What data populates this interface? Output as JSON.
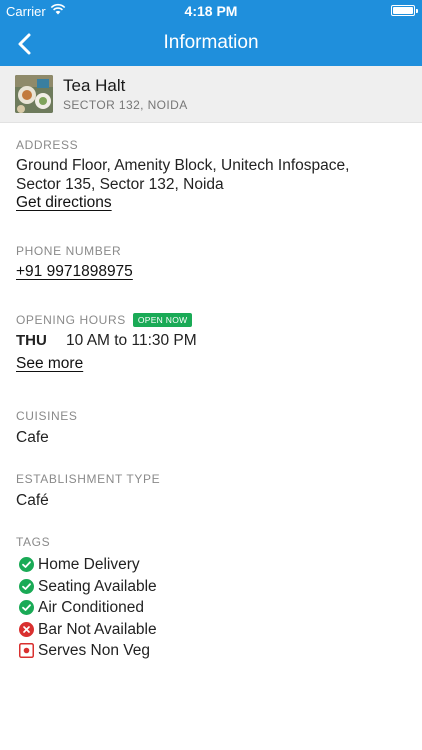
{
  "status_bar": {
    "carrier": "Carrier",
    "time": "4:18 PM"
  },
  "nav": {
    "title": "Information"
  },
  "restaurant": {
    "name": "Tea Halt",
    "location": "SECTOR 132, NOIDA"
  },
  "address": {
    "label": "ADDRESS",
    "line1": "Ground Floor, Amenity Block, Unitech Infospace,",
    "line2": "Sector 135, Sector 132, Noida",
    "directions_link": "Get directions"
  },
  "phone": {
    "label": "PHONE NUMBER",
    "number": "+91 9971898975"
  },
  "hours": {
    "label": "OPENING HOURS",
    "badge": "OPEN NOW",
    "day": "THU",
    "time": "10 AM to 11:30 PM",
    "see_more": "See more"
  },
  "cuisines": {
    "label": "CUISINES",
    "value": "Cafe"
  },
  "establishment": {
    "label": "ESTABLISHMENT TYPE",
    "value": "Café"
  },
  "tags": {
    "label": "TAGS",
    "items": [
      {
        "label": "Home Delivery",
        "status": "yes"
      },
      {
        "label": "Seating Available",
        "status": "yes"
      },
      {
        "label": "Air Conditioned",
        "status": "yes"
      },
      {
        "label": "Bar Not Available",
        "status": "no"
      },
      {
        "label": "Serves Non Veg",
        "status": "nonveg"
      }
    ]
  },
  "colors": {
    "header": "#1f8fdc",
    "open_badge": "#1aaa56",
    "check": "#1aaa56",
    "cross": "#d9302f",
    "nonveg": "#d9302f"
  }
}
